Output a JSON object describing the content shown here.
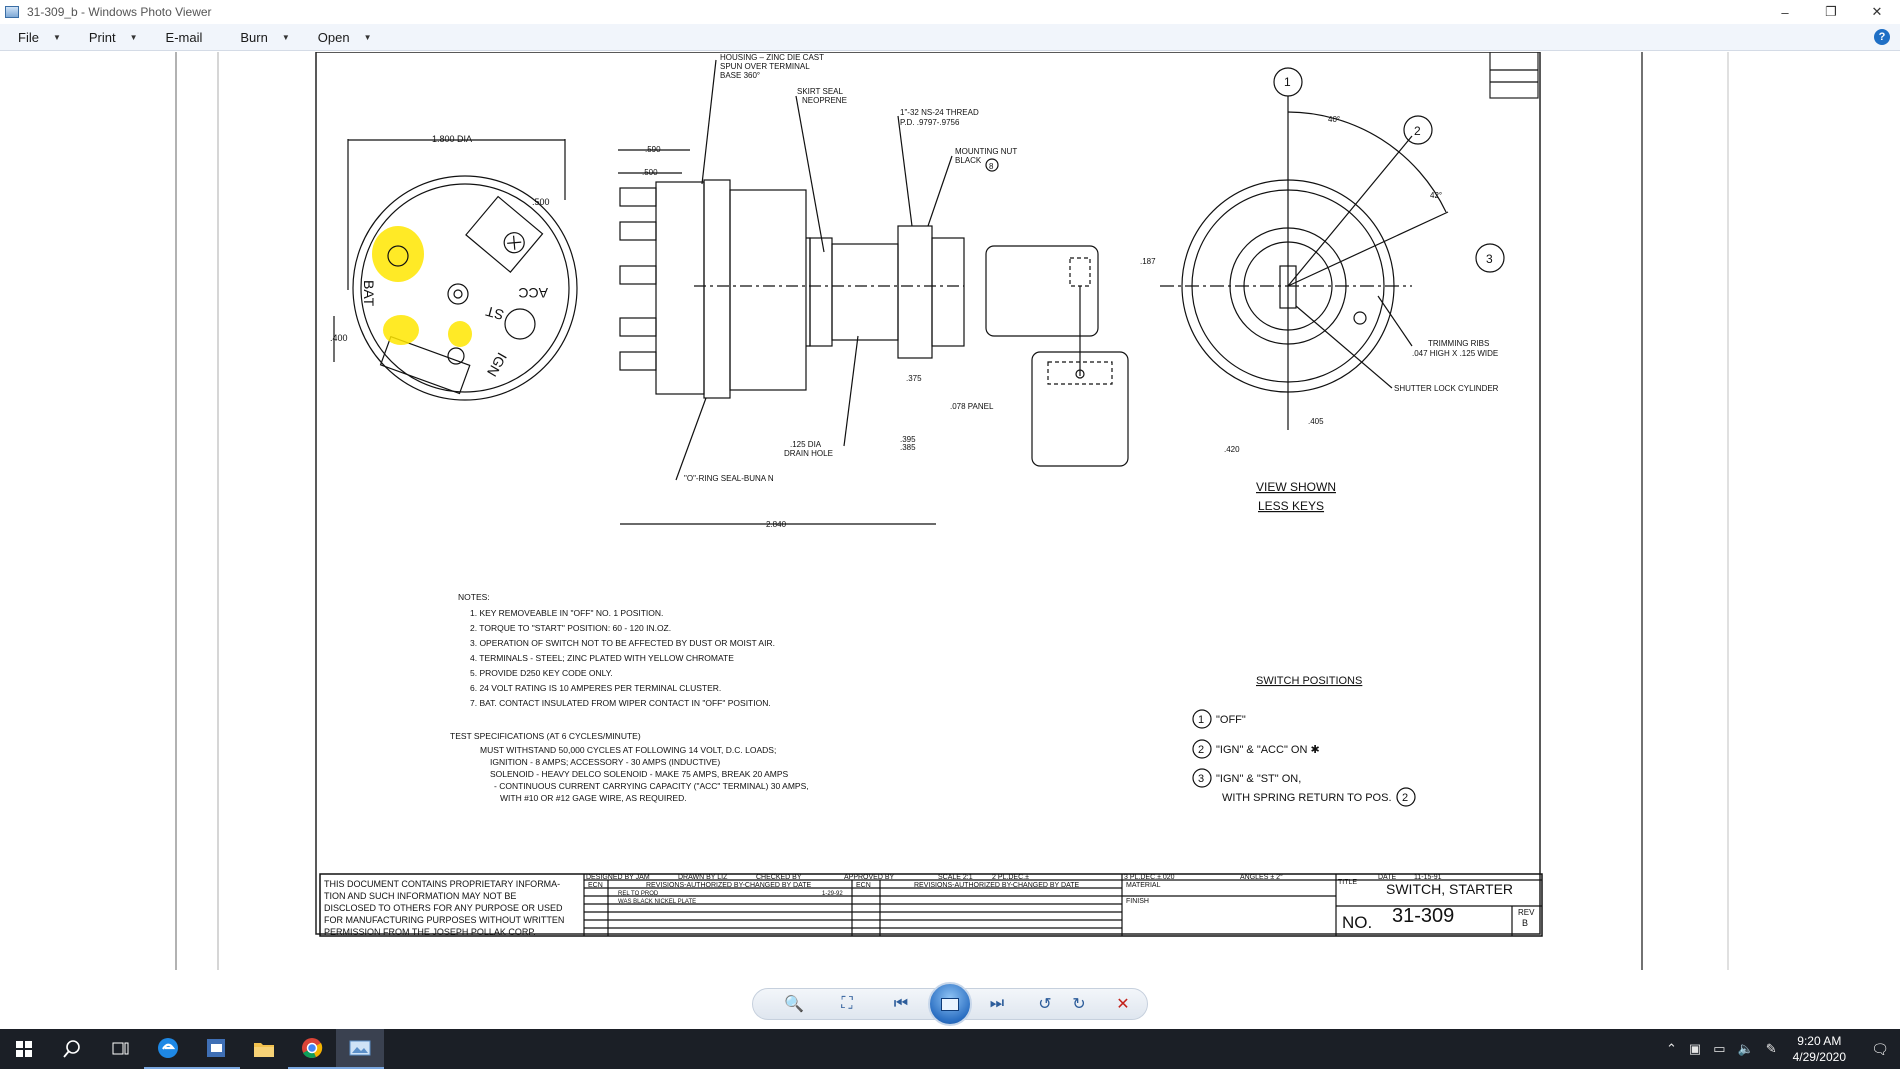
{
  "window": {
    "title": "31-309_b - Windows Photo Viewer",
    "minimize": "–",
    "maximize": "❐",
    "close": "✕"
  },
  "menu": {
    "items": [
      {
        "label": "File",
        "has_dropdown": true
      },
      {
        "label": "Print",
        "has_dropdown": true
      },
      {
        "label": "E-mail",
        "has_dropdown": false
      },
      {
        "label": "Burn",
        "has_dropdown": true
      },
      {
        "label": "Open",
        "has_dropdown": true
      }
    ],
    "help": "?"
  },
  "drawing": {
    "left_view": {
      "dia_label": "1.800 DIA",
      "dim_500": ".500",
      "dim_400": ".400",
      "term_bat": "BAT",
      "term_st": "ST",
      "term_acc": "ACC",
      "term_ign": "IGN"
    },
    "side_view": {
      "housing_1": "HOUSING – ZINC DIE CAST",
      "housing_2": "SPUN OVER TERMINAL",
      "housing_3": "BASE 360°",
      "skirt_1": "SKIRT SEAL",
      "skirt_2": "NEOPRENE",
      "thread_1": "1\"-32 NS-24 THREAD",
      "thread_2": "P.D. .9797-.9756",
      "nut_1": "MOUNTING NUT",
      "nut_2": "BLACK",
      "nut_num": "8",
      "dim_590": ".590",
      "dim_500": ".500",
      "dim_375": ".375",
      "panel": ".078 PANEL",
      "dim_395": ".395",
      "dim_385": ".385",
      "drain_1": ".125 DIA",
      "drain_2": "DRAIN HOLE",
      "oring": "\"O\"-RING SEAL-BUNA N",
      "dim_2840": "2.840"
    },
    "front_view": {
      "pos1": "1",
      "pos2": "2",
      "pos3": "3",
      "angle40": "40°",
      "angle42": "42°",
      "dim_187": ".187",
      "ribs_1": "TRIMMING RIBS",
      "ribs_2": ".047 HIGH X .125 WIDE",
      "shutter": "SHUTTER LOCK CYLINDER",
      "dim_405": ".405",
      "dim_420": ".420",
      "view_1": "VIEW SHOWN",
      "view_2": "LESS KEYS"
    },
    "notes": {
      "heading": "NOTES:",
      "lines": [
        "1.  KEY REMOVEABLE IN \"OFF\" NO. 1 POSITION.",
        "2.  TORQUE TO \"START\" POSITION: 60 - 120 IN.OZ.",
        "3.  OPERATION OF SWITCH NOT TO BE AFFECTED BY DUST OR MOIST AIR.",
        "4.  TERMINALS - STEEL; ZINC PLATED WITH YELLOW CHROMATE",
        "5.  PROVIDE D250 KEY CODE ONLY.",
        "6.  24 VOLT RATING IS 10 AMPERES PER TERMINAL CLUSTER.",
        "7.  BAT. CONTACT INSULATED FROM WIPER CONTACT IN \"OFF\" POSITION."
      ]
    },
    "test_specs": {
      "heading": "TEST SPECIFICATIONS (AT 6 CYCLES/MINUTE)",
      "lines": [
        "MUST WITHSTAND 50,000 CYCLES AT FOLLOWING 14 VOLT, D.C. LOADS;",
        "IGNITION - 8 AMPS; ACCESSORY - 30 AMPS (INDUCTIVE)",
        "SOLENOID - HEAVY DELCO SOLENOID - MAKE 75 AMPS, BREAK 20 AMPS",
        "- CONTINUOUS CURRENT CARRYING CAPACITY (\"ACC\" TERMINAL) 30 AMPS,",
        "WITH #10 OR #12 GAGE WIRE, AS REQUIRED."
      ]
    },
    "switch_positions": {
      "heading": "SWITCH POSITIONS",
      "p1_num": "1",
      "p1": "\"OFF\"",
      "p2_num": "2",
      "p2": "\"IGN\" & \"ACC\" ON ✱",
      "p3_num": "3",
      "p3": "\"IGN\" & \"ST\" ON,",
      "p3b": "WITH SPRING RETURN TO POS.",
      "p3b_num": "2"
    },
    "title_block": {
      "proprietary": [
        "THIS DOCUMENT CONTAINS PROPRIETARY INFORMA-",
        "TION AND SUCH INFORMATION MAY NOT BE",
        "DISCLOSED TO OTHERS FOR ANY PURPOSE OR USED",
        "FOR MANUFACTURING PURPOSES WITHOUT WRITTEN",
        "PERMISSION FROM THE JOSEPH POLLAK CORP."
      ],
      "designed": "DESIGNED BY JAM",
      "drawn": "DRAWN BY LIZ",
      "checked": "CHECKED BY",
      "approved": "APPROVED BY",
      "scale": "SCALE 2:1",
      "dec2": "2 PL.DEC.±",
      "dec3": "3 PL.DEC.±.020",
      "angles": "ANGLES ± 2°",
      "date": "DATE",
      "date_val": "11-15-91",
      "ecn": "ECN",
      "revisions1": "REVISIONS-AUTHORIZED BY-CHANGED BY DATE",
      "ecn2": "ECN",
      "revisions2": "REVISIONS-AUTHORIZED BY-CHANGED BY DATE",
      "material": "MATERIAL",
      "finish": "FINISH",
      "rel_prod": "REL TO PROD",
      "was_black": "WAS BLACK NICKEL PLATE",
      "rev_date": "1-29-92",
      "title_lbl": "TITLE",
      "title_val": "SWITCH, STARTER",
      "no_lbl": "NO.",
      "no_val": "31-309",
      "rev_lbl": "REV",
      "rev_val": "B"
    }
  },
  "toolbar": {
    "zoom": "🔍",
    "fit": "⛶",
    "prev": "⏮",
    "next": "⏭",
    "rotate_ccw": "↺",
    "rotate_cw": "↻",
    "delete": "✕"
  },
  "taskbar": {
    "time": "9:20 AM",
    "date": "4/29/2020"
  },
  "colors": {
    "highlight": "#ffe600",
    "taskbar": "#1b1f26",
    "menubar": "#f1f5fb"
  }
}
